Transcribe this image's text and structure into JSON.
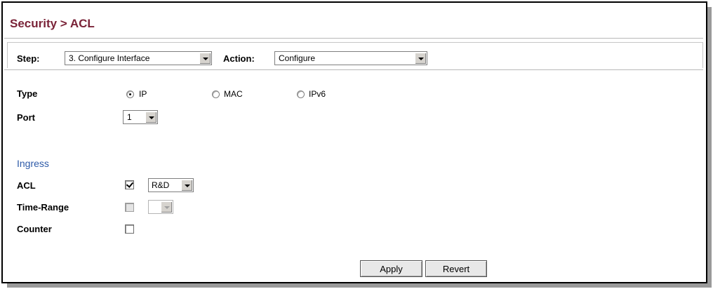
{
  "breadcrumb": "Security > ACL",
  "step": {
    "label": "Step:",
    "value": "3. Configure Interface"
  },
  "action": {
    "label": "Action:",
    "value": "Configure"
  },
  "type": {
    "label": "Type",
    "options": [
      {
        "label": "IP",
        "selected": true
      },
      {
        "label": "MAC",
        "selected": false
      },
      {
        "label": "IPv6",
        "selected": false
      }
    ]
  },
  "port": {
    "label": "Port",
    "value": "1"
  },
  "ingress": {
    "heading": "Ingress",
    "acl": {
      "label": "ACL",
      "checked": true,
      "value": "R&D"
    },
    "time_range": {
      "label": "Time-Range",
      "checked": false,
      "disabled": true,
      "value": ""
    },
    "counter": {
      "label": "Counter",
      "checked": false
    }
  },
  "buttons": {
    "apply": "Apply",
    "revert": "Revert"
  },
  "colors": {
    "title": "#7a2338",
    "section_heading": "#2d5aa8"
  }
}
